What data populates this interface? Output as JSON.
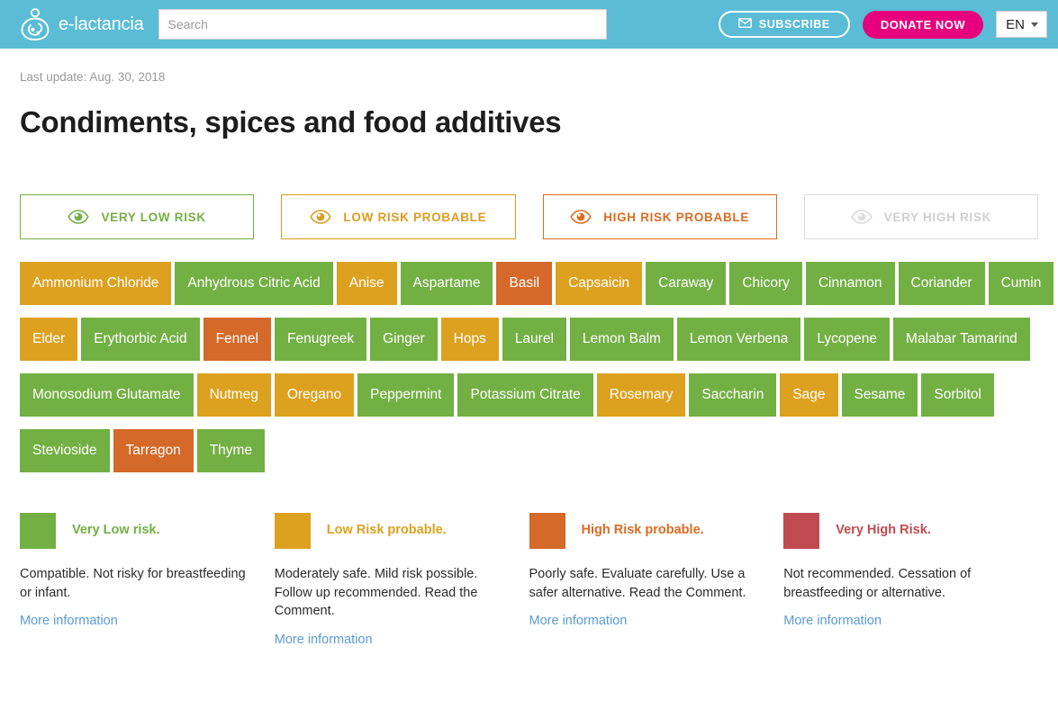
{
  "header": {
    "brand_name": "e-lactancia",
    "logo_icon": "breastfeeding-logo-icon",
    "search": {
      "placeholder": "Search",
      "value": ""
    },
    "subscribe_label": "SUBSCRIBE",
    "subscribe_icon": "envelope-icon",
    "donate_label": "DONATE NOW",
    "language": {
      "selected": "EN",
      "caret_icon": "chevron-down-icon"
    },
    "background_color": "#5BBCD5",
    "donate_color": "#E6007E"
  },
  "content": {
    "last_update": "Last update: Aug. 30, 2018",
    "title": "Condiments, spices and food additives"
  },
  "risk_filters": [
    {
      "label": "VERY LOW RISK",
      "level": "vlow",
      "icon": "eye-icon",
      "color": "#72B043"
    },
    {
      "label": "LOW RISK PROBABLE",
      "level": "low",
      "icon": "eye-icon",
      "color": "#DA9D1E"
    },
    {
      "label": "HIGH RISK PROBABLE",
      "level": "high",
      "icon": "eye-icon",
      "color": "#DD6B20"
    },
    {
      "label": "VERY HIGH RISK",
      "level": "vhigh",
      "icon": "eye-icon",
      "color": "#CFCFCF"
    }
  ],
  "tags": [
    [
      {
        "label": "Ammonium Chloride",
        "risk": "yellow"
      },
      {
        "label": "Anhydrous Citric Acid",
        "risk": "green"
      },
      {
        "label": "Anise",
        "risk": "yellow"
      },
      {
        "label": "Aspartame",
        "risk": "green"
      },
      {
        "label": "Basil",
        "risk": "orange"
      },
      {
        "label": "Capsaicin",
        "risk": "yellow"
      },
      {
        "label": "Caraway",
        "risk": "green"
      },
      {
        "label": "Chicory",
        "risk": "green"
      },
      {
        "label": "Cinnamon",
        "risk": "green"
      },
      {
        "label": "Coriander",
        "risk": "green"
      },
      {
        "label": "Cumin",
        "risk": "green"
      }
    ],
    [
      {
        "label": "Elder",
        "risk": "yellow"
      },
      {
        "label": "Erythorbic Acid",
        "risk": "green"
      },
      {
        "label": "Fennel",
        "risk": "orange"
      },
      {
        "label": "Fenugreek",
        "risk": "green"
      },
      {
        "label": "Ginger",
        "risk": "green"
      },
      {
        "label": "Hops",
        "risk": "yellow"
      },
      {
        "label": "Laurel",
        "risk": "green"
      },
      {
        "label": "Lemon Balm",
        "risk": "green"
      },
      {
        "label": "Lemon Verbena",
        "risk": "green"
      },
      {
        "label": "Lycopene",
        "risk": "green"
      },
      {
        "label": "Malabar Tamarind",
        "risk": "green"
      }
    ],
    [
      {
        "label": "Monosodium Glutamate",
        "risk": "green"
      },
      {
        "label": "Nutmeg",
        "risk": "yellow"
      },
      {
        "label": "Oregano",
        "risk": "yellow"
      },
      {
        "label": "Peppermint",
        "risk": "green"
      },
      {
        "label": "Potassium Citrate",
        "risk": "green"
      },
      {
        "label": "Rosemary",
        "risk": "yellow"
      },
      {
        "label": "Saccharin",
        "risk": "green"
      },
      {
        "label": "Sage",
        "risk": "yellow"
      },
      {
        "label": "Sesame",
        "risk": "green"
      },
      {
        "label": "Sorbitol",
        "risk": "green"
      }
    ],
    [
      {
        "label": "Stevioside",
        "risk": "green"
      },
      {
        "label": "Tarragon",
        "risk": "orange"
      },
      {
        "label": "Thyme",
        "risk": "green"
      }
    ]
  ],
  "legend": [
    {
      "title": "Very Low risk.",
      "color_class": "green",
      "color": "#72B043",
      "description": "Compatible. Not risky for breastfeeding or infant.",
      "link": "More information"
    },
    {
      "title": "Low Risk probable.",
      "color_class": "yellow",
      "color": "#DDA120",
      "description": "Moderately safe. Mild risk possible. Follow up recommended. Read the Comment.",
      "link": "More information"
    },
    {
      "title": "High Risk probable.",
      "color_class": "orange",
      "color": "#D4692A",
      "description": "Poorly safe. Evaluate carefully. Use a safer alternative. Read the Comment.",
      "link": "More information"
    },
    {
      "title": "Very High Risk.",
      "color_class": "red",
      "color": "#C04A50",
      "description": "Not recommended. Cessation of breastfeeding or alternative.",
      "link": "More information"
    }
  ]
}
